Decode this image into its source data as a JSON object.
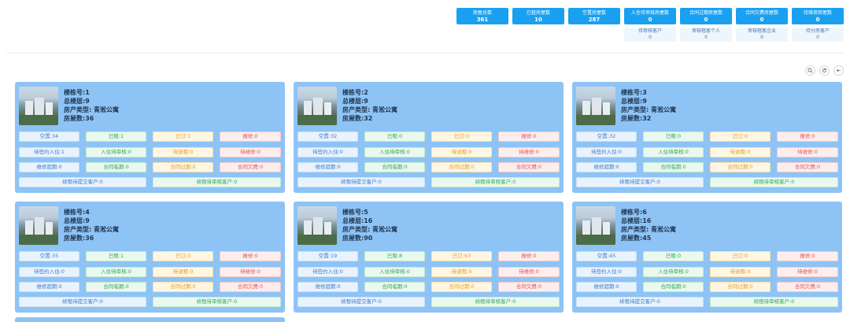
{
  "stats": [
    {
      "label": "房屋总数",
      "value": "361"
    },
    {
      "label": "已租房屋数",
      "value": "10"
    },
    {
      "label": "空置房屋数",
      "value": "287"
    },
    {
      "label": "入住待审核房屋数",
      "value": "0",
      "sub": {
        "label": "待审核客户",
        "value": "0"
      }
    },
    {
      "label": "合同过期房屋数",
      "value": "0",
      "sub": {
        "label": "审核租客个人",
        "value": "0"
      }
    },
    {
      "label": "合同欠费房屋数",
      "value": "0",
      "sub": {
        "label": "审核租客企业",
        "value": "0"
      }
    },
    {
      "label": "待维修房屋数",
      "value": "0",
      "sub": {
        "label": "待分房客户",
        "value": "0"
      }
    }
  ],
  "toolbar": {
    "search_icon": "search-icon",
    "refresh_icon": "refresh-icon",
    "back_icon": "back-icon"
  },
  "cards": [
    {
      "building": "楼栋号:1",
      "floors": "总楼层:9",
      "type": "房产类型: 青淞公寓",
      "rooms": "房屋数:36",
      "r1": [
        "空置:34",
        "已租:1",
        "已订:1",
        "报修:0"
      ],
      "r2": [
        "待签约入住:1",
        "入住待审核:0",
        "待退租:0",
        "待维修:0"
      ],
      "r3": [
        "维修超期:0",
        "合同临期:0",
        "合同过期:0",
        "合同欠费:0"
      ],
      "r4": [
        "续租待提交客户:0",
        "续租待审核客户:0"
      ]
    },
    {
      "building": "楼栋号:2",
      "floors": "总楼层:9",
      "type": "房产类型: 青淞公寓",
      "rooms": "房屋数:32",
      "r1": [
        "空置:32",
        "已租:0",
        "已订:0",
        "报修:0"
      ],
      "r2": [
        "待签约入住:0",
        "入住待审核:0",
        "待退租:0",
        "待维修:0"
      ],
      "r3": [
        "维修超期:0",
        "合同临期:0",
        "合同过期:0",
        "合同欠费:0"
      ],
      "r4": [
        "续租待提交客户:0",
        "续租待审核客户:0"
      ]
    },
    {
      "building": "楼栋号:3",
      "floors": "总楼层:9",
      "type": "房产类型: 青淞公寓",
      "rooms": "房屋数:32",
      "r1": [
        "空置:32",
        "已租:0",
        "已订:0",
        "报修:0"
      ],
      "r2": [
        "待签约入住:0",
        "入住待审核:0",
        "待退租:0",
        "待维修:0"
      ],
      "r3": [
        "维修超期:0",
        "合同临期:0",
        "合同过期:0",
        "合同欠费:0"
      ],
      "r4": [
        "续租待提交客户:0",
        "续租待审核客户:0"
      ]
    },
    {
      "building": "楼栋号:4",
      "floors": "总楼层:9",
      "type": "房产类型: 青淞公寓",
      "rooms": "房屋数:36",
      "r1": [
        "空置:35",
        "已租:1",
        "已订:0",
        "报修:0"
      ],
      "r2": [
        "待签约入住:0",
        "入住待审核:0",
        "待退租:0",
        "待维修:0"
      ],
      "r3": [
        "维修超期:0",
        "合同临期:0",
        "合同过期:0",
        "合同欠费:0"
      ],
      "r4": [
        "续租待提交客户:0",
        "续租待审核客户:0"
      ]
    },
    {
      "building": "楼栋号:5",
      "floors": "总楼层:16",
      "type": "房产类型: 青淞公寓",
      "rooms": "房屋数:90",
      "r1": [
        "空置:19",
        "已租:8",
        "已订:63",
        "报修:0"
      ],
      "r2": [
        "待签约入住:0",
        "入住待审核:0",
        "待退租:0",
        "待维修:0"
      ],
      "r3": [
        "维修超期:0",
        "合同临期:0",
        "合同过期:0",
        "合同欠费:0"
      ],
      "r4": [
        "续租待提交客户:0",
        "续租待审核客户:0"
      ]
    },
    {
      "building": "楼栋号:6",
      "floors": "总楼层:16",
      "type": "房产类型: 青淞公寓",
      "rooms": "房屋数:45",
      "r1": [
        "空置:45",
        "已租:0",
        "已订:0",
        "报修:0"
      ],
      "r2": [
        "待签约入住:0",
        "入住待审核:0",
        "待退租:0",
        "待维修:0"
      ],
      "r3": [
        "维修超期:0",
        "合同临期:0",
        "合同过期:0",
        "合同欠费:0"
      ],
      "r4": [
        "续租待提交客户:0",
        "续租待审核客户:0"
      ]
    }
  ]
}
